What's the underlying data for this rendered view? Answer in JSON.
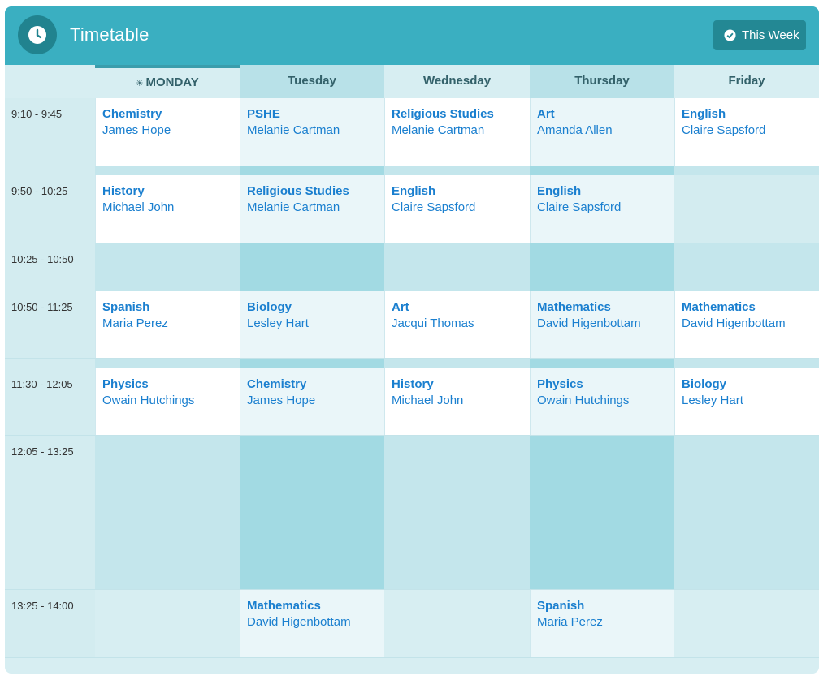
{
  "header": {
    "title": "Timetable",
    "week_button": "This Week",
    "accent": "#3aafc1"
  },
  "days": [
    "MONDAY",
    "Tuesday",
    "Wednesday",
    "Thursday",
    "Friday"
  ],
  "current_day_index": 0,
  "current_day_marker": "✳",
  "periods": [
    {
      "time": "9:10 - 9:45",
      "lessons": [
        {
          "subject": "Chemistry",
          "teacher": "James Hope"
        },
        {
          "subject": "PSHE",
          "teacher": "Melanie Cartman"
        },
        {
          "subject": "Religious Studies",
          "teacher": "Melanie Cartman"
        },
        {
          "subject": "Art",
          "teacher": "Amanda Allen"
        },
        {
          "subject": "English",
          "teacher": "Claire Sapsford"
        }
      ]
    },
    {
      "time": "9:50 - 10:25",
      "lessons": [
        {
          "subject": "History",
          "teacher": "Michael John"
        },
        {
          "subject": "Religious Studies",
          "teacher": "Melanie Cartman"
        },
        {
          "subject": "English",
          "teacher": "Claire Sapsford"
        },
        {
          "subject": "English",
          "teacher": "Claire Sapsford"
        },
        null
      ]
    },
    {
      "time": "10:25 - 10:50",
      "lessons": [
        null,
        null,
        null,
        null,
        null
      ]
    },
    {
      "time": "10:50 - 11:25",
      "lessons": [
        {
          "subject": "Spanish",
          "teacher": "Maria Perez"
        },
        {
          "subject": "Biology",
          "teacher": "Lesley Hart"
        },
        {
          "subject": "Art",
          "teacher": "Jacqui Thomas"
        },
        {
          "subject": "Mathematics",
          "teacher": "David Higenbottam"
        },
        {
          "subject": "Mathematics",
          "teacher": "David Higenbottam"
        }
      ]
    },
    {
      "time": "11:30 - 12:05",
      "lessons": [
        {
          "subject": "Physics",
          "teacher": "Owain Hutchings"
        },
        {
          "subject": "Chemistry",
          "teacher": "James Hope"
        },
        {
          "subject": "History",
          "teacher": "Michael John"
        },
        {
          "subject": "Physics",
          "teacher": "Owain Hutchings"
        },
        {
          "subject": "Biology",
          "teacher": "Lesley Hart"
        }
      ]
    },
    {
      "time": "12:05 - 13:25",
      "lessons": [
        null,
        null,
        null,
        null,
        null
      ]
    },
    {
      "time": "13:25 - 14:00",
      "lessons": [
        null,
        {
          "subject": "Mathematics",
          "teacher": "David Higenbottam"
        },
        null,
        {
          "subject": "Spanish",
          "teacher": "Maria Perez"
        },
        null
      ]
    }
  ]
}
